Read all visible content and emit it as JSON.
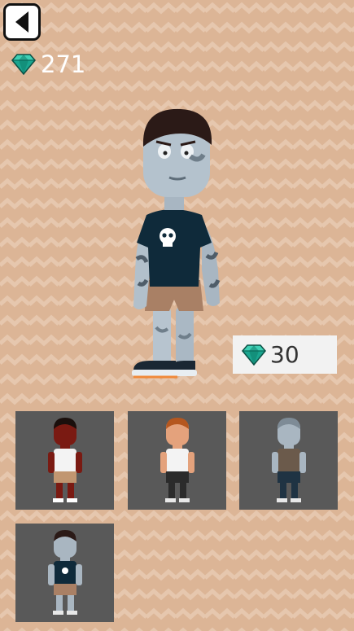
{
  "header": {
    "back_icon": "back-arrow-icon",
    "gem_icon": "gem-icon",
    "gem_count": "271"
  },
  "preview": {
    "character": "zombie-character",
    "price": "30",
    "price_icon": "gem-icon"
  },
  "skins": [
    {
      "name": "red-skin-character"
    },
    {
      "name": "orange-hair-character"
    },
    {
      "name": "gray-zombie-character"
    },
    {
      "name": "skull-shirt-zombie-character"
    }
  ],
  "colors": {
    "background": "#dcb596",
    "pattern": "#e6c7ae",
    "tile": "#595959",
    "gem": "#1aa58f",
    "price_bg": "#f2f2f2"
  }
}
